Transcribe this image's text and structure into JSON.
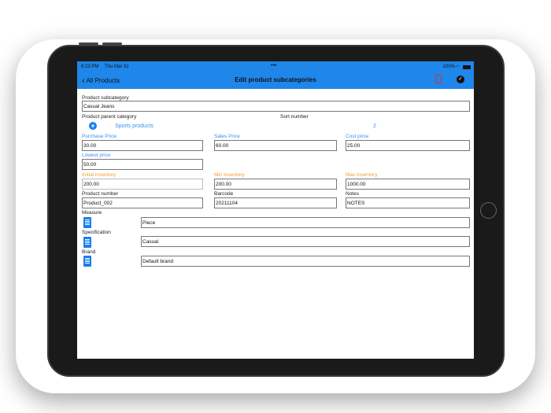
{
  "status": {
    "time": "6:23 PM",
    "date": "Thu Mar 31",
    "battery": "100%"
  },
  "nav": {
    "back_label": "All Products",
    "title": "Edit product subcategories"
  },
  "form": {
    "subcategory_label": "Product subcategory",
    "subcategory_value": "Casual Jeans",
    "parent_label": "Product parent category",
    "parent_value": "Sports products",
    "sort_label": "Sort number",
    "sort_value": "2",
    "purchase_label": "Purchase Price",
    "purchase_value": "30.00",
    "sales_label": "Sales Price",
    "sales_value": "60.00",
    "cost_label": "Cost price",
    "cost_value": "25.00",
    "lowest_label": "Lowest price",
    "lowest_value": "50.00",
    "initial_label": "Initial inventory",
    "initial_value": "200.00",
    "min_label": "Min inventory",
    "min_value": "200.00",
    "max_label": "Max inventory",
    "max_value": "1000.00",
    "number_label": "Product number",
    "number_value": "Product_002",
    "barcode_label": "Barcode",
    "barcode_value": "20211104",
    "notes_label": "Notes",
    "notes_value": "NOTES",
    "measure_label": "Measure",
    "measure_value": "Piece",
    "spec_label": "Specification",
    "spec_value": "Casual",
    "brand_label": "Brand",
    "brand_value": "Default brand"
  }
}
